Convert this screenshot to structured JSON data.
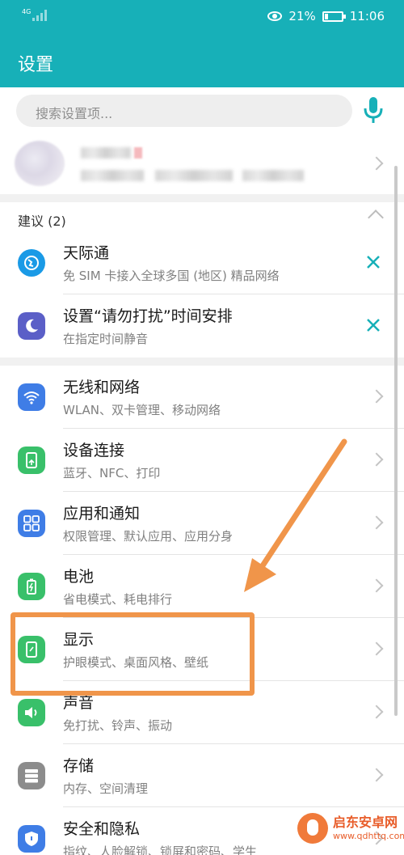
{
  "status_bar": {
    "network": "4G",
    "battery_percent": "21%",
    "battery_level": 0.21,
    "time": "11:06"
  },
  "app_bar": {
    "title": "设置"
  },
  "search": {
    "placeholder": "搜索设置项..."
  },
  "suggestions": {
    "header": "建议 (2)",
    "items": [
      {
        "title": "天际通",
        "subtitle": "免 SIM 卡接入全球多国 (地区) 精品网络",
        "icon": "globe-icon",
        "icon_color": "#1a9ae6"
      },
      {
        "title": "设置“请勿打扰”时间安排",
        "subtitle": "在指定时间静音",
        "icon": "moon-icon",
        "icon_color": "#5b5fc7"
      }
    ]
  },
  "settings": {
    "items": [
      {
        "title": "无线和网络",
        "subtitle": "WLAN、双卡管理、移动网络",
        "icon": "wifi-icon",
        "icon_color": "#3f7de6"
      },
      {
        "title": "设备连接",
        "subtitle": "蓝牙、NFC、打印",
        "icon": "device-connect-icon",
        "icon_color": "#39c06a"
      },
      {
        "title": "应用和通知",
        "subtitle": "权限管理、默认应用、应用分身",
        "icon": "apps-grid-icon",
        "icon_color": "#3f7de6"
      },
      {
        "title": "电池",
        "subtitle": "省电模式、耗电排行",
        "icon": "battery-icon",
        "icon_color": "#39c06a"
      },
      {
        "title": "显示",
        "subtitle": "护眼模式、桌面风格、壁纸",
        "icon": "display-icon",
        "icon_color": "#39c06a"
      },
      {
        "title": "声音",
        "subtitle": "免打扰、铃声、振动",
        "icon": "speaker-icon",
        "icon_color": "#39c06a"
      },
      {
        "title": "存储",
        "subtitle": "内存、空间清理",
        "icon": "storage-icon",
        "icon_color": "#8c8c8c"
      },
      {
        "title": "安全和隐私",
        "subtitle": "指纹、人脸解锁、锁屏和密码、学生",
        "icon": "shield-icon",
        "icon_color": "#3f7de6"
      }
    ]
  },
  "watermark": {
    "name": "启东安卓网",
    "url": "www.qdhttq.com"
  },
  "colors": {
    "accent": "#17b0b8",
    "highlight": "#f0954a"
  }
}
